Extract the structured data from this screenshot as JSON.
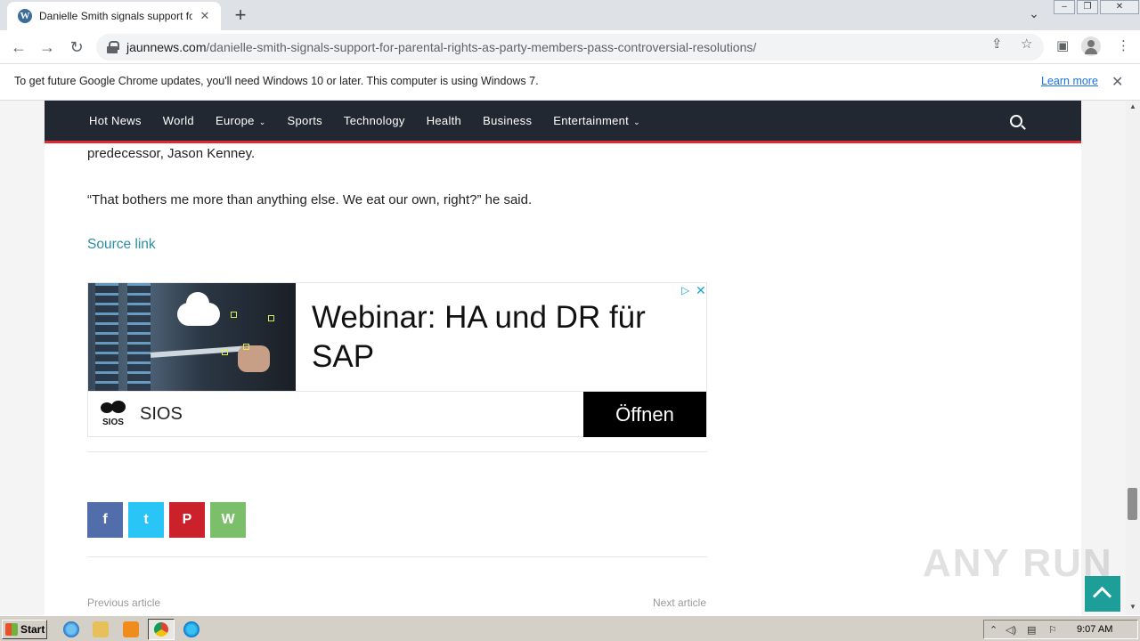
{
  "browser": {
    "tab_title": "Danielle Smith signals support for 'pa",
    "tab_favicon": "W",
    "new_tab": "+",
    "url_host": "jaunnews.com",
    "url_path": "/danielle-smith-signals-support-for-parental-rights-as-party-members-pass-controversial-resolutions/",
    "infobar_message": "To get future Google Chrome updates, you'll need Windows 10 or later. This computer is using Windows 7.",
    "infobar_link": "Learn more"
  },
  "nav": {
    "items": [
      "Hot News",
      "World",
      "Europe",
      "Sports",
      "Technology",
      "Health",
      "Business",
      "Entertainment"
    ],
    "caret": "⌄"
  },
  "article": {
    "para1": "predecessor, Jason Kenney.",
    "para2": "“That bothers me more than anything else. We eat our own, right?” he said.",
    "source_link": "Source link"
  },
  "ad": {
    "headline": "Webinar: HA und DR für SAP",
    "brand": "SIOS",
    "logo_text": "SIOS",
    "cta": "Öffnen",
    "choices_icon": "▷",
    "close_icon": "✕"
  },
  "share": {
    "facebook": "f",
    "twitter": "t",
    "pinterest": "P",
    "whatsapp": "W"
  },
  "post_nav": {
    "previous": "Previous article",
    "next": "Next article"
  },
  "watermark": "ANY RUN",
  "taskbar": {
    "start": "Start",
    "clock": "9:07 AM"
  },
  "colors": {
    "nav_bg": "#222831",
    "nav_accent": "#e0262f",
    "link": "#2a8fa3",
    "scroll_top": "#1d9e98"
  }
}
